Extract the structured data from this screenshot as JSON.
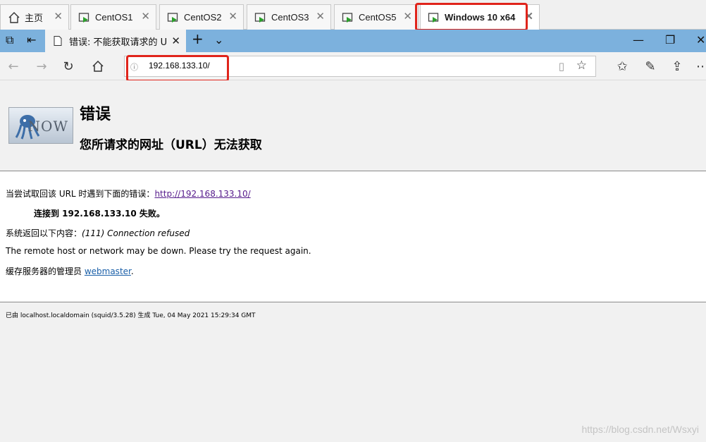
{
  "vm_tabs": [
    {
      "label": "主页"
    },
    {
      "label": "CentOS1"
    },
    {
      "label": "CentOS2"
    },
    {
      "label": "CentOS3"
    },
    {
      "label": "CentOS5"
    },
    {
      "label": "Windows 10 x64"
    }
  ],
  "browser": {
    "tab_title": "错误: 不能获取请求的 U",
    "address": "192.168.133.10/"
  },
  "page": {
    "heading": "错误",
    "subheading": "您所请求的网址（URL）无法获取",
    "logo_text": "NOW",
    "attempt_prefix": "当尝试取回该 URL 时遇到下面的错误：",
    "attempt_link": "http://192.168.133.10/",
    "connect_fail": "连接到 192.168.133.10 失败。",
    "system_prefix": "系统返回以下内容：",
    "system_msg": "(111) Connection refused",
    "remote_msg": "The remote host or network may be down. Please try the request again.",
    "cache_prefix": "缓存服务器的管理员 ",
    "webmaster": "webmaster",
    "period": ".",
    "footer": "已由 localhost.localdomain (squid/3.5.28) 生成 Tue, 04 May 2021 15:29:34 GMT"
  },
  "watermark": "https://blog.csdn.net/Wsxyi",
  "colors": {
    "highlight": "#e0241b",
    "titlebar": "#7cb1dd",
    "link_visited": "#551a8b",
    "link": "#1a5fa8"
  }
}
